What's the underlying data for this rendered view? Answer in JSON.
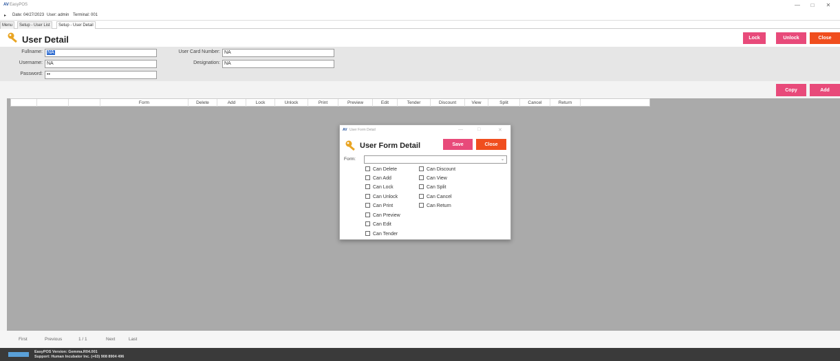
{
  "titlebar": {
    "app_logo": "AV",
    "app_name": "EasyPOS",
    "minimize": "—",
    "maximize": "□",
    "close": "✕"
  },
  "infobar": {
    "menu_glyph": "▸",
    "date": "Date: 04/27/2023",
    "user": "User: admin",
    "terminal": "Terminal: 001"
  },
  "tabs": [
    {
      "label": "Menu"
    },
    {
      "label": "Setup - User List"
    },
    {
      "label": "Setup - User Detail"
    }
  ],
  "page": {
    "title": "User Detail",
    "icon": "key-icon"
  },
  "header_buttons": {
    "lock": "Lock",
    "unlock": "Unlock",
    "close": "Close"
  },
  "form": {
    "fullname_label": "Fullname:",
    "fullname_value": "NA",
    "username_label": "Username:",
    "username_value": "NA",
    "password_label": "Password:",
    "password_value": "••",
    "card_label": "User Card Number:",
    "card_value": "NA",
    "designation_label": "Designation:",
    "designation_value": "NA"
  },
  "grid_buttons": {
    "copy": "Copy",
    "add": "Add"
  },
  "grid": {
    "columns": [
      "",
      "",
      "",
      "Form",
      "Delete",
      "Add",
      "Lock",
      "Unlock",
      "Print",
      "Preview",
      "Edit",
      "Tender",
      "Discount",
      "View",
      "Split",
      "Cancel",
      "Return"
    ]
  },
  "pager": {
    "first": "First",
    "previous": "Previous",
    "page": "1 / 1",
    "next": "Next",
    "last": "Last"
  },
  "footer": {
    "version": "EasyPOS Version: Gemma.R04.001",
    "support": "Support: Human Incubator Inc. (+63) 908 8904 496"
  },
  "dialog": {
    "window_logo": "AV",
    "window_title": "User Form Detail",
    "min": "—",
    "max": "□",
    "close_x": "✕",
    "title": "User Form Detail",
    "save": "Save",
    "close": "Close",
    "form_label": "Form:",
    "form_value": "",
    "caret": "⌄",
    "left_checks": [
      {
        "label": "Can Delete"
      },
      {
        "label": "Can Add"
      },
      {
        "label": "Can Lock"
      },
      {
        "label": "Can Unlock"
      },
      {
        "label": "Can Print"
      },
      {
        "label": "Can Preview"
      },
      {
        "label": "Can Edit"
      },
      {
        "label": "Can Tender"
      }
    ],
    "right_checks": [
      {
        "label": "Can Discount"
      },
      {
        "label": "Can View"
      },
      {
        "label": "Can Split"
      },
      {
        "label": "Can Cancel"
      },
      {
        "label": "Can Return"
      }
    ]
  },
  "colors": {
    "pink": "#e84a7a",
    "orange": "#f04e1e",
    "grid_bg": "#aaaaaa",
    "footer_bg": "#3a3a3a"
  }
}
